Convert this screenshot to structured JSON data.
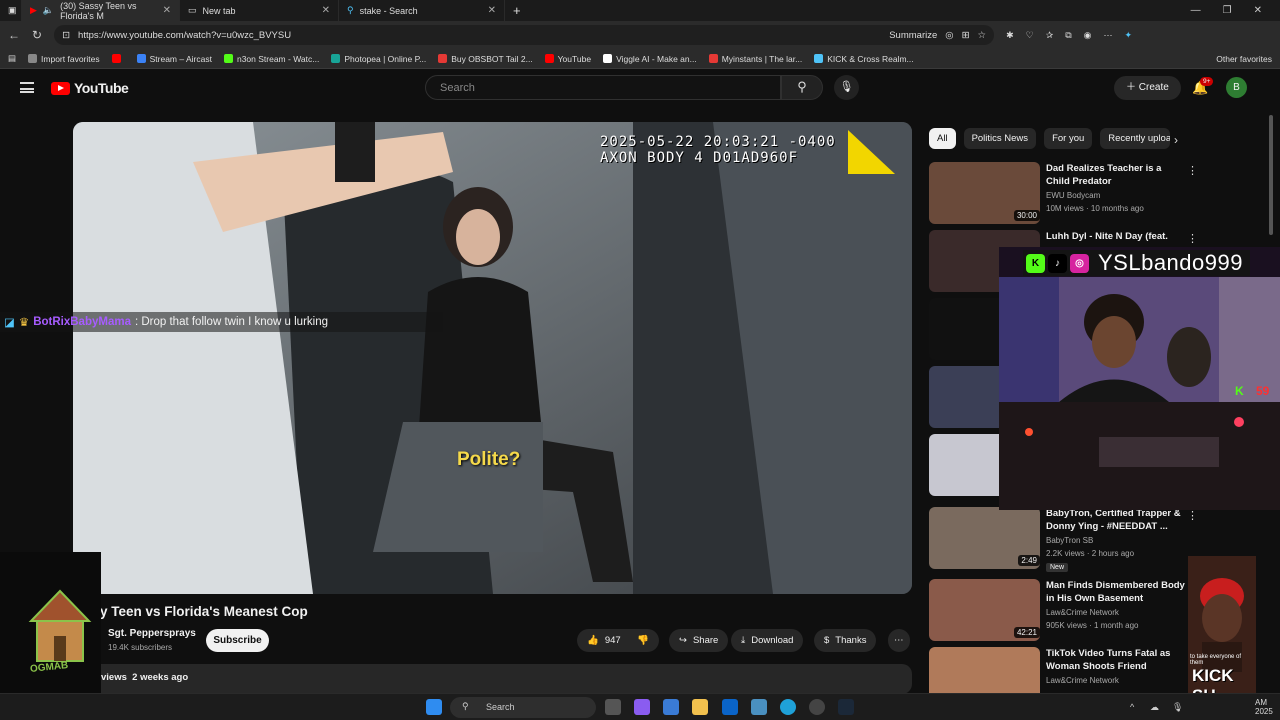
{
  "browser": {
    "tabs": [
      {
        "label": "(30) Sassy Teen vs Florida's M",
        "active": true
      },
      {
        "label": "New tab",
        "active": false
      },
      {
        "label": "stake - Search",
        "active": false
      }
    ],
    "url": "https://www.youtube.com/watch?v=u0wzc_BVYSU",
    "summarize_label": "Summarize",
    "bookmarks": [
      {
        "label": "Import favorites",
        "color": "#888888"
      },
      {
        "label": "",
        "color": "#ff0000"
      },
      {
        "label": "Stream – Aircast",
        "color": "#3b82f6"
      },
      {
        "label": "n3on Stream - Watc...",
        "color": "#53fc18"
      },
      {
        "label": "Photopea | Online P...",
        "color": "#18a497"
      },
      {
        "label": "Buy OBSBOT Tail 2...",
        "color": "#e53935"
      },
      {
        "label": "YouTube",
        "color": "#ff0000"
      },
      {
        "label": "Viggle AI - Make an...",
        "color": "#ffffff"
      },
      {
        "label": "Myinstants | The lar...",
        "color": "#e53935"
      },
      {
        "label": "KICK & Cross Realm...",
        "color": "#4fc3f7"
      }
    ],
    "other_favorites": "Other favorites"
  },
  "youtube": {
    "logo_text": "YouTube",
    "search_placeholder": "Search",
    "create_label": "Create",
    "notif_count": "9+",
    "avatar_letter": "B"
  },
  "video": {
    "timestamp_line1": "2025-05-22 20:03:21 -0400",
    "timestamp_line2": "AXON BODY 4 D01AD960F",
    "caption": "Polite?",
    "title": "y Teen vs Florida's Meanest Cop",
    "channel": "Sgt. Peppersprays",
    "subscribers": "19.4K subscribers",
    "subscribe_label": "Subscribe",
    "likes": "947",
    "share_label": "Share",
    "download_label": "Download",
    "thanks_label": "Thanks",
    "views": "views",
    "age": "2 weeks ago"
  },
  "chat": {
    "user": "BotRixBabyMama",
    "message": ": Drop that follow twin I know u lurking"
  },
  "chips": [
    "All",
    "Politics News",
    "For you",
    "Recently uploa"
  ],
  "recommendations": [
    {
      "title": "Dad Realizes Teacher is a Child Predator",
      "channel": "EWU Bodycam",
      "meta": "10M views · 10 months ago",
      "duration": "30:00",
      "color": "#6a4a3a"
    },
    {
      "title": "Luhh Dyl - Nite N Day (feat.",
      "channel": "",
      "meta": "",
      "duration": "",
      "color": "#3a2a2a"
    },
    {
      "title": "",
      "channel": "",
      "meta": "",
      "duration": "",
      "color": "#111111"
    },
    {
      "title": "",
      "channel": "",
      "meta": "",
      "duration": "",
      "color": "#3b3f56"
    },
    {
      "title": "",
      "channel": "",
      "meta": "",
      "duration": "",
      "color": "#c7c7d0"
    },
    {
      "title": "BabyTron, Certified Trapper & Donny Ying - #NEEDDAT ...",
      "channel": "BabyTron SB",
      "meta": "2.2K views · 2 hours ago",
      "duration": "2:49",
      "badge": "New",
      "color": "#7a6a5e"
    },
    {
      "title": "Man Finds Dismembered Body in His Own Basement",
      "channel": "Law&Crime Network",
      "meta": "905K views · 1 month ago",
      "duration": "42:21",
      "color": "#8a5a4a"
    },
    {
      "title": "TikTok Video Turns Fatal as Woman Shoots Friend",
      "channel": "Law&Crime Network",
      "meta": "",
      "duration": "",
      "color": "#b07a5a"
    }
  ],
  "stream_overlay": {
    "handle": "YSLbando999",
    "kick_count": "59"
  },
  "sticker": {
    "text": "OGMAB"
  },
  "persona": {
    "small_text": "to take everyone of them",
    "big_text": "KICK SU"
  },
  "taskbar": {
    "search_label": "Search",
    "clock_line1": "AM",
    "clock_line2": "2025"
  }
}
